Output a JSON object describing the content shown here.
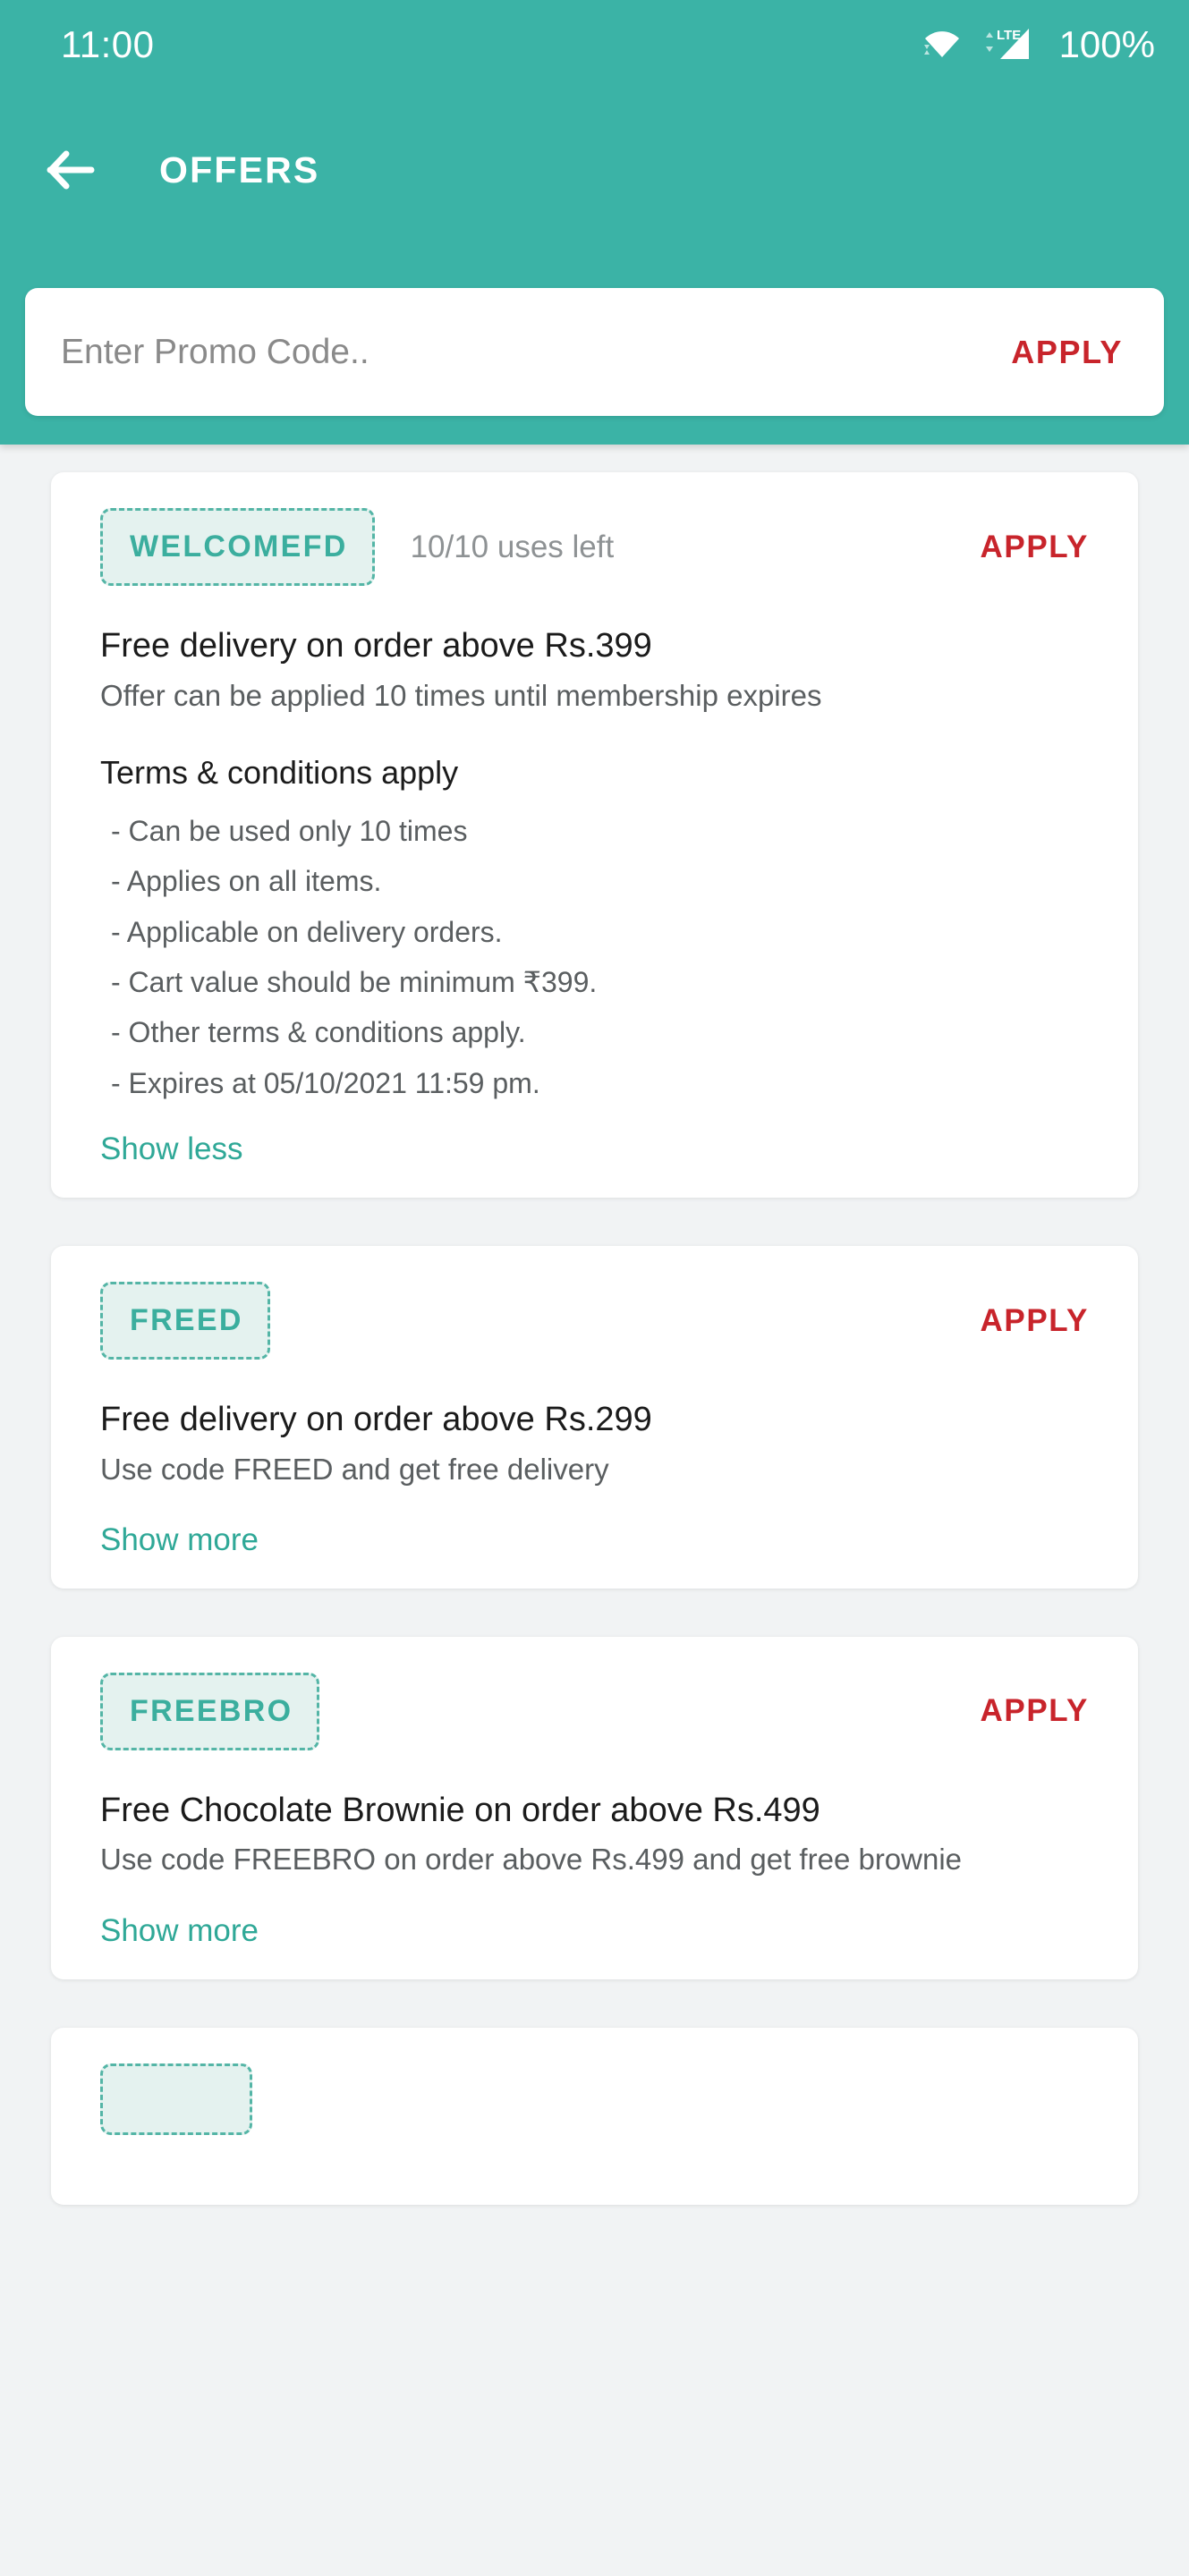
{
  "status_bar": {
    "time": "11:00",
    "battery": "100%",
    "icons": [
      "wifi-icon",
      "lte-signal-icon"
    ]
  },
  "app_bar": {
    "back_label": "back-arrow-icon",
    "title": "OFFERS"
  },
  "promo": {
    "placeholder": "Enter Promo Code..",
    "value": "",
    "apply_label": "APPLY"
  },
  "colors": {
    "primary_teal": "#3BB3A6",
    "link_teal": "#2FA897",
    "chip_text": "#3BAE9E",
    "chip_bg": "#E4F2EF",
    "apply_red": "#C8242B",
    "page_bg": "#F1F3F4",
    "card_bg": "#FFFFFF"
  },
  "offers": [
    {
      "code": "WELCOMEFD",
      "uses_left": "10/10 uses left",
      "apply_label": "APPLY",
      "title": "Free delivery on order above Rs.399",
      "subtitle": "Offer can be applied 10 times until membership expires",
      "expanded": true,
      "terms_heading": "Terms & conditions apply",
      "terms": [
        "- Can be used only 10 times",
        "- Applies on all items.",
        "- Applicable on delivery orders.",
        "- Cart value should be minimum ₹399.",
        "- Other terms & conditions apply.",
        "- Expires at 05/10/2021 11:59 pm."
      ],
      "toggle_label": "Show less"
    },
    {
      "code": "FREED",
      "uses_left": "",
      "apply_label": "APPLY",
      "title": "Free delivery on order above Rs.299",
      "subtitle": "Use code FREED and get free delivery",
      "expanded": false,
      "terms_heading": "",
      "terms": [],
      "toggle_label": "Show more"
    },
    {
      "code": "FREEBRO",
      "uses_left": "",
      "apply_label": "APPLY",
      "title": "Free Chocolate Brownie on order above Rs.499",
      "subtitle": "Use code FREEBRO on order above Rs.499 and get free brownie",
      "expanded": false,
      "terms_heading": "",
      "terms": [],
      "toggle_label": "Show more"
    },
    {
      "code": "",
      "uses_left": "",
      "apply_label": "",
      "title": "",
      "subtitle": "",
      "expanded": false,
      "terms_heading": "",
      "terms": [],
      "toggle_label": ""
    }
  ]
}
